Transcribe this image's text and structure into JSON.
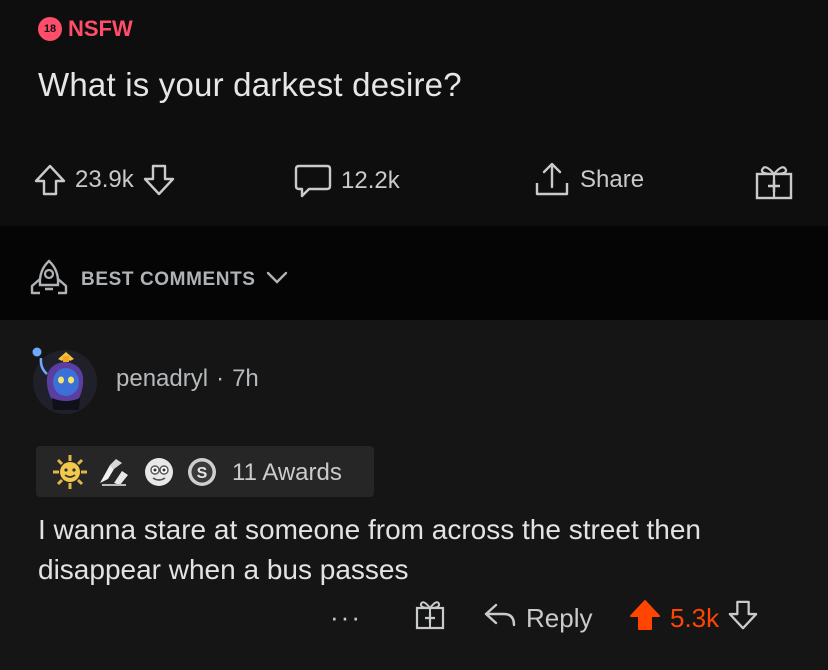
{
  "post": {
    "nsfw_badge": "18",
    "nsfw_label": "NSFW",
    "title": "What is your darkest desire?",
    "upvotes": "23.9k",
    "comments": "12.2k",
    "share_label": "Share"
  },
  "sort": {
    "label": "BEST COMMENTS"
  },
  "comment": {
    "username": "penadryl",
    "separator": "·",
    "time": "7h",
    "awards_text": "11 Awards",
    "body": "I wanna stare at someone from across the street then disappear when a bus passes",
    "more": "···",
    "reply_label": "Reply",
    "score": "5.3k"
  },
  "colors": {
    "accent_nsfw": "#ff4d6a",
    "upvoted": "#ff4500",
    "background": "#0e0e0e",
    "comment_bg": "#151515"
  },
  "icons": [
    "upvote-icon",
    "downvote-icon",
    "comment-bubble-icon",
    "share-icon",
    "gift-icon",
    "rocket-icon",
    "chevron-down-icon",
    "reply-icon"
  ]
}
